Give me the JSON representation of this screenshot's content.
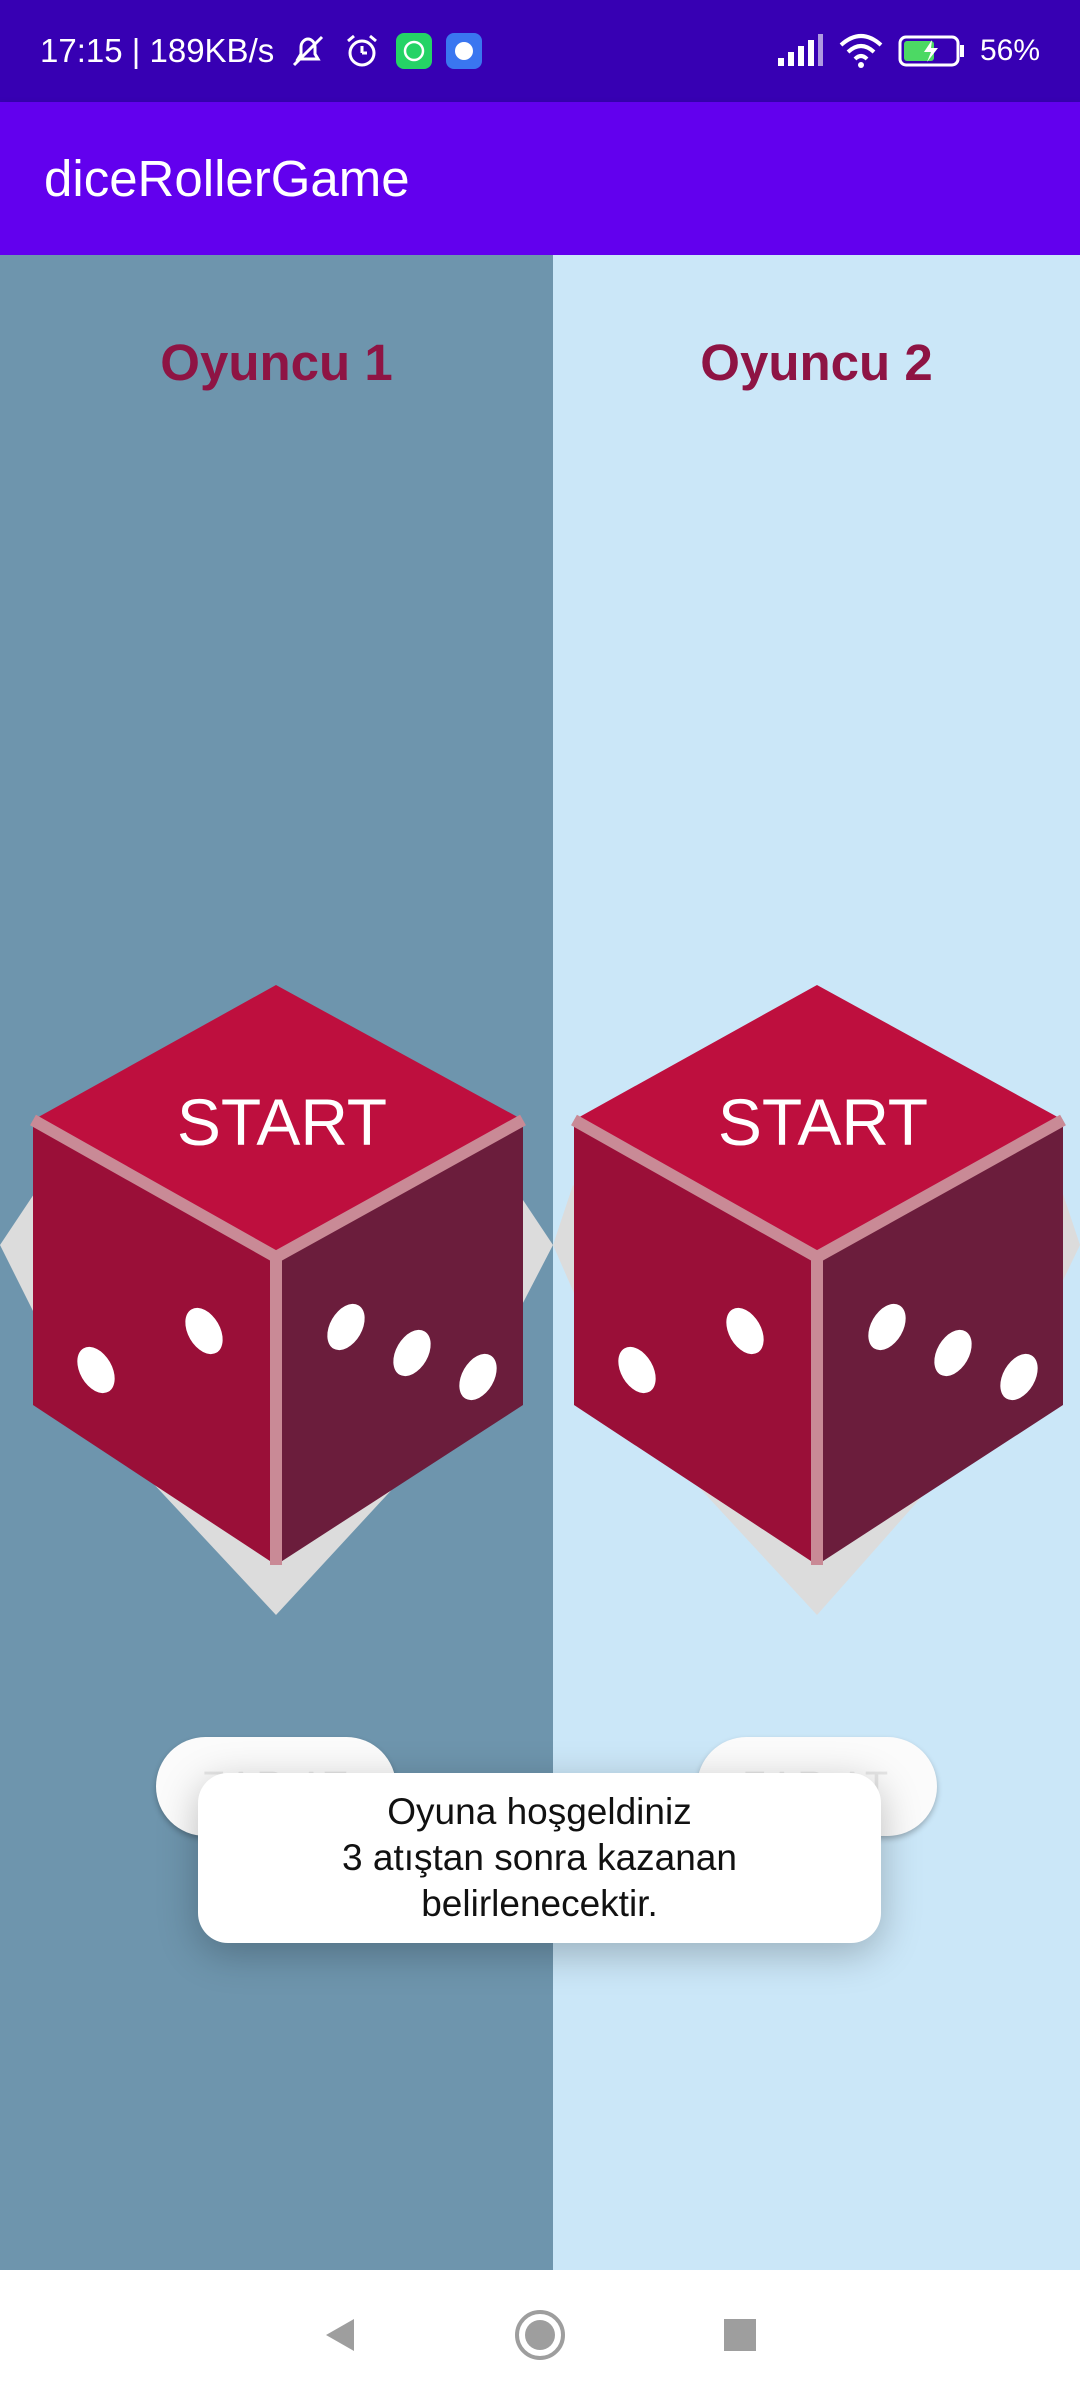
{
  "status_bar": {
    "time_speed": "17:15 | 189KB/s",
    "battery": "56%",
    "icons": [
      "mute-icon",
      "alarm-icon",
      "whatsapp-icon",
      "signal-app-icon",
      "cell-signal-icon",
      "wifi-icon",
      "battery-icon"
    ]
  },
  "app_bar": {
    "title": "diceRollerGame"
  },
  "players": [
    {
      "name": "Oyuncu 1",
      "dice_face_text": "START",
      "button_label": "ZAR AT"
    },
    {
      "name": "Oyuncu 2",
      "dice_face_text": "START",
      "button_label": "ZAR AT"
    }
  ],
  "toast": {
    "line1": "Oyuna hoşgeldiniz",
    "line2": "3 atıştan sonra kazanan",
    "line3": "belirlenecektir."
  },
  "colors": {
    "status_bar": "#3700b3",
    "app_bar": "#6200ee",
    "left_panel": "#6e95ad",
    "right_panel": "#cbe7f8",
    "player_title": "#8e1444",
    "dice_top": "#be0f3e",
    "dice_left": "#9a0f38",
    "dice_right": "#6b1d3c"
  },
  "nav": {
    "icons": [
      "back-icon",
      "home-icon",
      "recents-icon"
    ]
  }
}
